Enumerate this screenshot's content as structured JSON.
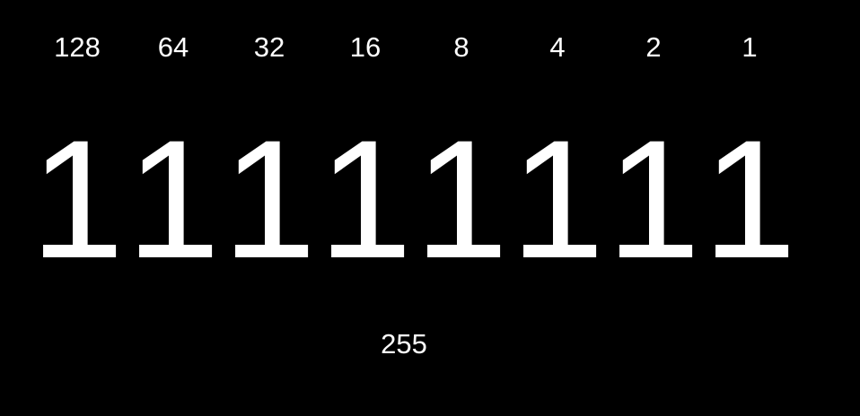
{
  "place_values": [
    "128",
    "64",
    "32",
    "16",
    "8",
    "4",
    "2",
    "1"
  ],
  "bits": [
    "1",
    "1",
    "1",
    "1",
    "1",
    "1",
    "1",
    "1"
  ],
  "total": "255"
}
